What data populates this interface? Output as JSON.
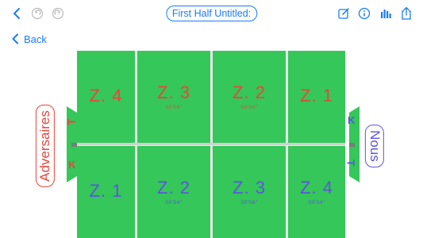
{
  "toolbar": {
    "title": "First Half Untitled:"
  },
  "nav": {
    "back_label": "Back"
  },
  "zones_top": [
    {
      "label": "Z. 4",
      "time": ""
    },
    {
      "label": "Z. 3",
      "time": "00'04\""
    },
    {
      "label": "Z. 2",
      "time": "00'04\""
    },
    {
      "label": "Z. 1",
      "time": ""
    }
  ],
  "zones_bottom": [
    {
      "label": "Z. 1",
      "time": ""
    },
    {
      "label": "Z. 2",
      "time": "00'04\""
    },
    {
      "label": "Z. 3",
      "time": "00'06\""
    },
    {
      "label": "Z. 4",
      "time": "00'04\""
    }
  ],
  "teams": {
    "left": {
      "name": "Adversaires",
      "k": "K",
      "t": "T"
    },
    "right": {
      "name": "Nous",
      "k": "K",
      "t": "T"
    }
  },
  "colors": {
    "accent": "#1a7cf5",
    "field_green": "#35c759",
    "opponent_red": "#e8453c",
    "us_blue": "#5b54e0"
  }
}
